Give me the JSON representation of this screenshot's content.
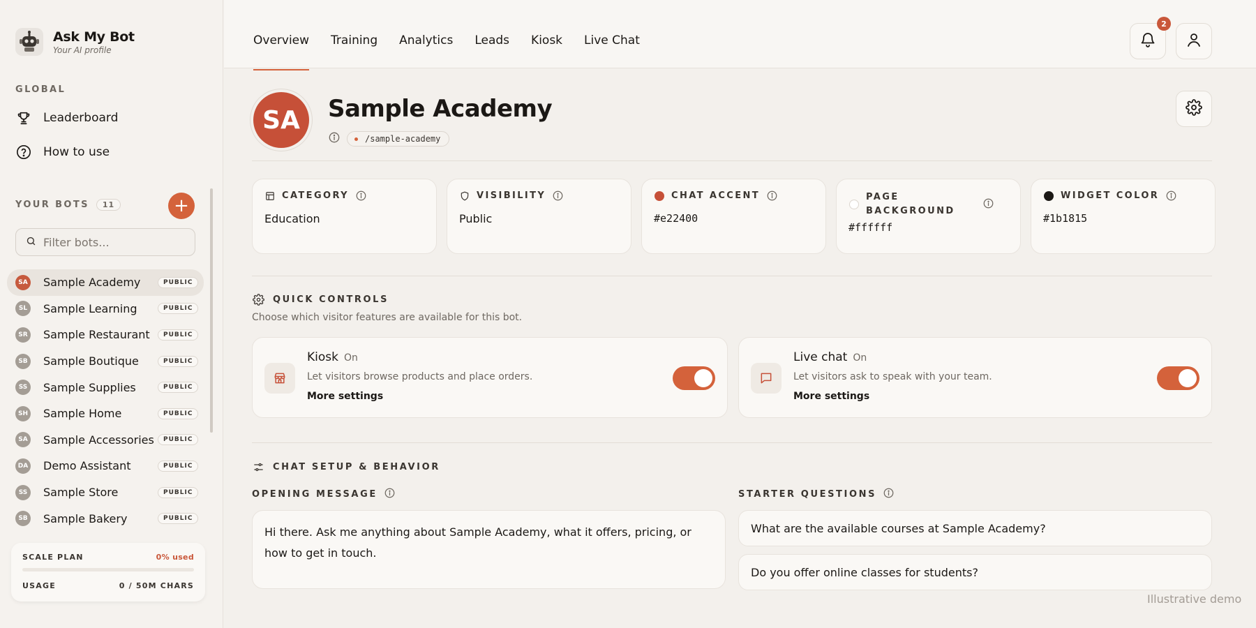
{
  "brand": {
    "name": "Ask My Bot",
    "subtitle": "Your AI profile"
  },
  "sidebar": {
    "global_label": "GLOBAL",
    "global_items": [
      {
        "label": "Leaderboard",
        "icon": "trophy-icon"
      },
      {
        "label": "How to use",
        "icon": "help-circle-icon"
      }
    ],
    "bots_label": "YOUR BOTS",
    "bots_count": "11",
    "add_label": "+",
    "filter_placeholder": "Filter bots...",
    "bots": [
      {
        "initials": "SA",
        "name": "Sample Academy",
        "badge": "PUBLIC",
        "active": true
      },
      {
        "initials": "SL",
        "name": "Sample Learning",
        "badge": "PUBLIC"
      },
      {
        "initials": "SR",
        "name": "Sample Restaurant",
        "badge": "PUBLIC"
      },
      {
        "initials": "SB",
        "name": "Sample Boutique",
        "badge": "PUBLIC"
      },
      {
        "initials": "SS",
        "name": "Sample Supplies",
        "badge": "PUBLIC"
      },
      {
        "initials": "SH",
        "name": "Sample Home",
        "badge": "PUBLIC"
      },
      {
        "initials": "SA",
        "name": "Sample Accessories",
        "badge": "PUBLIC"
      },
      {
        "initials": "DA",
        "name": "Demo Assistant",
        "badge": "PUBLIC"
      },
      {
        "initials": "SS",
        "name": "Sample Store",
        "badge": "PUBLIC"
      },
      {
        "initials": "SB",
        "name": "Sample Bakery",
        "badge": "PUBLIC"
      }
    ],
    "plan": {
      "name": "SCALE PLAN",
      "used": "0% used",
      "used_fraction": 0,
      "usage_label": "USAGE",
      "usage_value": "0 / 50M CHARS"
    }
  },
  "topnav": {
    "tabs": [
      "Overview",
      "Training",
      "Analytics",
      "Leads",
      "Kiosk",
      "Live Chat"
    ],
    "active_tab": "Overview",
    "notifications_count": "2"
  },
  "bot": {
    "initials": "SA",
    "name": "Sample Academy",
    "slug": "/sample-academy"
  },
  "properties": [
    {
      "label": "CATEGORY",
      "value": "Education",
      "icon": "layout-icon"
    },
    {
      "label": "VISIBILITY",
      "value": "Public",
      "icon": "shield-icon"
    },
    {
      "label": "CHAT ACCENT",
      "value": "#e22400",
      "swatch": "#c65038"
    },
    {
      "label": "PAGE BACKGROUND",
      "value": "#ffffff",
      "swatch": "#ffffff"
    },
    {
      "label": "WIDGET COLOR",
      "value": "#1b1815",
      "swatch": "#1b1815"
    }
  ],
  "quick_controls": {
    "title": "QUICK CONTROLS",
    "description": "Choose which visitor features are available for this bot.",
    "items": [
      {
        "title": "Kiosk",
        "status": "On",
        "description": "Let visitors browse products and place orders.",
        "more": "More settings",
        "enabled": true,
        "icon": "store-icon"
      },
      {
        "title": "Live chat",
        "status": "On",
        "description": "Let visitors ask to speak with your team.",
        "more": "More settings",
        "enabled": true,
        "icon": "chat-bubble-icon"
      }
    ]
  },
  "chat_setup": {
    "title": "CHAT SETUP & BEHAVIOR",
    "opening_label": "OPENING MESSAGE",
    "opening_message": "Hi there. Ask me anything about Sample Academy, what it offers, pricing, or how to get in touch.",
    "starter_label": "STARTER QUESTIONS",
    "starter_questions": [
      "What are the available courses at Sample Academy?",
      "Do you offer online classes for students?"
    ]
  },
  "watermark": "Illustrative demo",
  "colors": {
    "accent": "#d4623b",
    "avatar": "#c65038",
    "text": "#1b1815",
    "bg": "#f3f0ec"
  }
}
